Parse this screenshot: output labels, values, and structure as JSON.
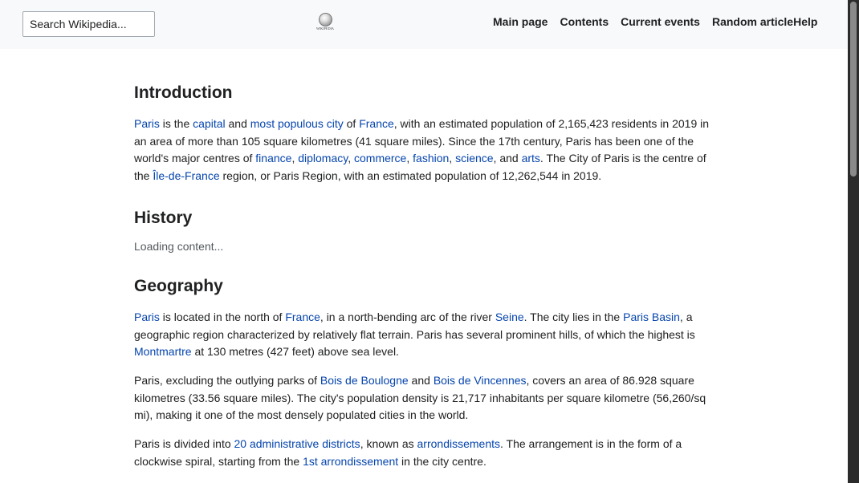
{
  "header": {
    "search_placeholder": "Search Wikipedia...",
    "logo_text": "WIKIPEDIA The Free Encyclopedia",
    "nav": [
      "Main page",
      "Contents",
      "Current events",
      "Random article",
      "Help"
    ]
  },
  "sections": {
    "intro": {
      "title": "Introduction",
      "p1": {
        "t0": "Paris",
        "t1": " is the ",
        "t2": "capital",
        "t3": " and ",
        "t4": "most populous city",
        "t5": " of ",
        "t6": "France",
        "t7": ", with an estimated population of 2,165,423 residents in 2019 in an area of more than 105 square kilometres (41 square miles). Since the 17th century, Paris has been one of the world's major centres of ",
        "t8": "finance",
        "t9": ", ",
        "t10": "diplomacy",
        "t11": ", ",
        "t12": "commerce",
        "t13": ", ",
        "t14": "fashion",
        "t15": ", ",
        "t16": "science",
        "t17": ", and ",
        "t18": "arts",
        "t19": ". The City of Paris is the centre of the ",
        "t20": "Île-de-France",
        "t21": " region, or Paris Region, with an estimated population of 12,262,544 in 2019."
      }
    },
    "history": {
      "title": "History",
      "loading": "Loading content..."
    },
    "geography": {
      "title": "Geography",
      "p1": {
        "t0": "Paris",
        "t1": " is located in the north of ",
        "t2": "France",
        "t3": ", in a north-bending arc of the river ",
        "t4": "Seine",
        "t5": ". The city lies in the ",
        "t6": "Paris Basin",
        "t7": ", a geographic region characterized by relatively flat terrain. Paris has several prominent hills, of which the highest is ",
        "t8": "Montmartre",
        "t9": " at 130 metres (427 feet) above sea level."
      },
      "p2": {
        "t0": "Paris, excluding the outlying parks of ",
        "t1": "Bois de Boulogne",
        "t2": " and ",
        "t3": "Bois de Vincennes",
        "t4": ", covers an area of 86.928 square kilometres (33.56 square miles). The city's population density is 21,717 inhabitants per square kilometre (56,260/sq mi), making it one of the most densely populated cities in the world."
      },
      "p3": {
        "t0": "Paris is divided into ",
        "t1": "20 administrative districts",
        "t2": ", known as ",
        "t3": "arrondissements",
        "t4": ". The arrangement is in the form of a clockwise spiral, starting from the ",
        "t5": "1st arrondissement",
        "t6": " in the city centre."
      }
    }
  },
  "colors": {
    "link": "#0645ad",
    "text": "#202122",
    "header_bg": "#f8f9fa"
  }
}
